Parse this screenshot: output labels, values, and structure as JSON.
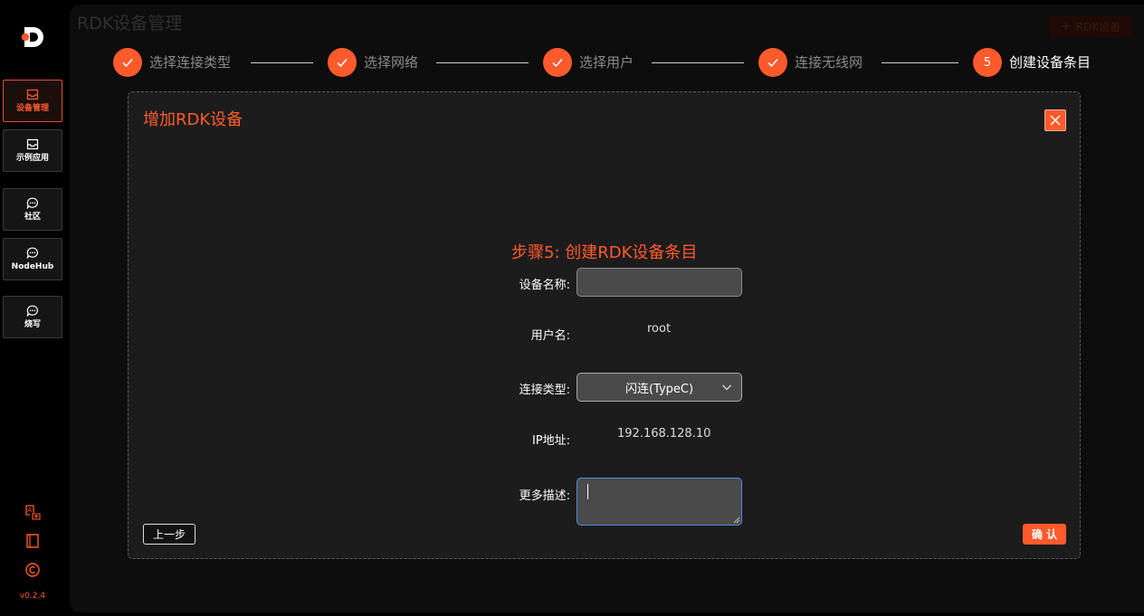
{
  "app": {
    "title": "RDK设备管理",
    "version": "v0.2.4",
    "add_button": "RDK设备"
  },
  "sidebar": {
    "items": [
      {
        "label": "设备管理",
        "icon": "inbox-icon"
      },
      {
        "label": "示例应用",
        "icon": "inbox-icon"
      },
      {
        "label": "社区",
        "icon": "chat-icon"
      },
      {
        "label": "NodeHub",
        "icon": "chat-icon"
      },
      {
        "label": "烧写",
        "icon": "chat-icon"
      }
    ],
    "tools": [
      "translate-icon",
      "book-icon",
      "copyright-icon"
    ]
  },
  "steps": [
    {
      "label": "选择连接类型",
      "status": "done"
    },
    {
      "label": "选择网络",
      "status": "done"
    },
    {
      "label": "选择用户",
      "status": "done"
    },
    {
      "label": "连接无线网",
      "status": "done"
    },
    {
      "label": "创建设备条目",
      "status": "current",
      "number": "5"
    }
  ],
  "dialog": {
    "title": "增加RDK设备",
    "section_title": "步骤5: 创建RDK设备条目",
    "fields": {
      "device_name": {
        "label": "设备名称:",
        "value": ""
      },
      "username": {
        "label": "用户名:",
        "value": "root"
      },
      "connection_type": {
        "label": "连接类型:",
        "value": "闪连(TypeC)"
      },
      "ip": {
        "label": "IP地址:",
        "value": "192.168.128.10"
      },
      "description": {
        "label": "更多描述:",
        "value": ""
      }
    },
    "prev_button": "上一步",
    "confirm_button": "确 认"
  },
  "colors": {
    "accent": "#ff5a2c",
    "background": "#000000",
    "panel": "#1c1c1c"
  }
}
